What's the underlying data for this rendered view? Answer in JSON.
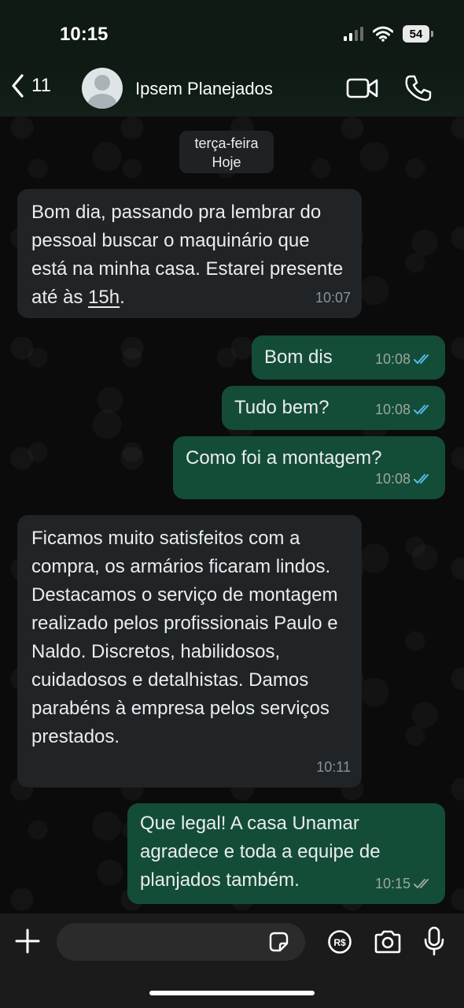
{
  "status": {
    "time": "10:15",
    "battery": "54"
  },
  "header": {
    "back_count": "11",
    "contact_name": "Ipsem Planejados"
  },
  "date_chip": {
    "day": "terça-feira",
    "label": "Hoje"
  },
  "messages": [
    {
      "dir": "in",
      "text_a": "Bom dia, passando pra lembrar do pessoal buscar o maquinário que está na minha casa. Estarei presente até às ",
      "link": "15h",
      "text_b": ".",
      "time": "10:07"
    },
    {
      "dir": "out",
      "text": "Bom dis",
      "time": "10:08"
    },
    {
      "dir": "out",
      "text": "Tudo bem?",
      "time": "10:08"
    },
    {
      "dir": "out",
      "text": "Como foi a montagem?",
      "time": "10:08"
    },
    {
      "dir": "in",
      "text": "Ficamos muito satisfeitos com a compra, os armários ficaram lindos. Destacamos o serviço de montagem realizado pelos profissionais Paulo e Naldo. Discretos, habilidosos, cuidadosos e detalhistas. Damos parabéns à empresa pelos serviços prestados.",
      "time": "10:11"
    },
    {
      "dir": "out",
      "text": "Que legal! A casa Unamar agradece e toda a equipe de planjados também.",
      "time": "10:15"
    }
  ],
  "colors": {
    "outgoing": "#144d37",
    "incoming": "#202427",
    "read_ticks": "#53bdeb",
    "delivered_ticks": "#9aa6a0"
  },
  "icons": [
    "back-chevron-icon",
    "video-call-icon",
    "phone-icon",
    "plus-icon",
    "sticker-icon",
    "pix-payment-icon",
    "camera-icon",
    "mic-icon"
  ]
}
